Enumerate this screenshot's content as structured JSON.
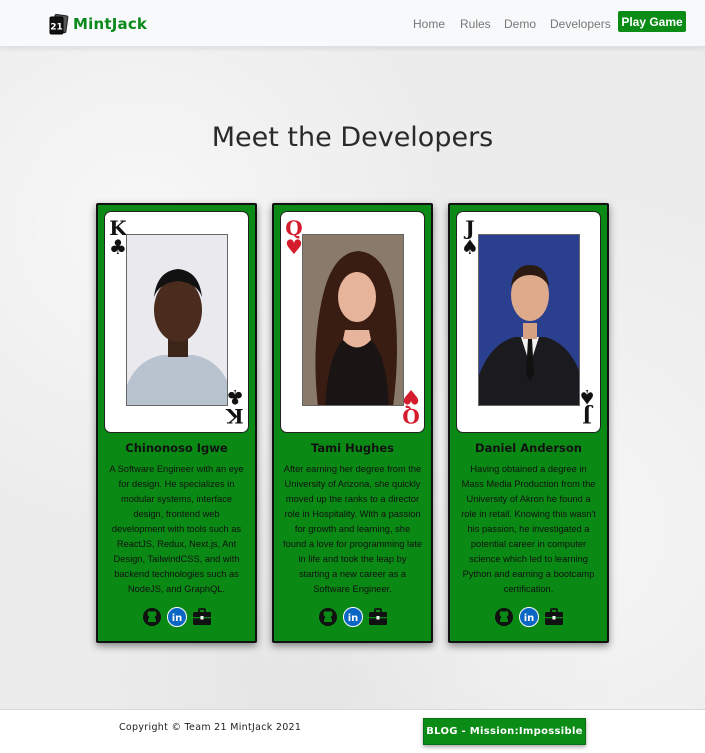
{
  "brand": {
    "name": "MintJack",
    "logo_text": "21"
  },
  "nav": {
    "links": [
      "Home",
      "Rules",
      "Demo",
      "Developers"
    ],
    "play_button": "Play Game"
  },
  "page": {
    "title": "Meet the Developers"
  },
  "developers": [
    {
      "name": "Chinonoso Igwe",
      "card_rank": "K",
      "card_suit": "♣",
      "card_color": "black",
      "bio": "A Software Engineer with an eye for design. He specializes in modular systems, interface design, frontend web development with tools such as ReactJS, Redux, Next.js, Ant Design, TailwindCSS, and with backend technologies such as NodeJS, and GraphQL.",
      "photo_icon": "person-photo"
    },
    {
      "name": "Tami Hughes",
      "card_rank": "Q",
      "card_suit": "♥",
      "card_color": "red",
      "bio": "After earning her degree from the University of Arizona, she quickly moved up the ranks to a director role in Hospitality. With a passion for growth and learning, she found a love for programming late in life and took the leap by starting a new career as a Software Engineer.",
      "photo_icon": "person-photo"
    },
    {
      "name": "Daniel Anderson",
      "card_rank": "J",
      "card_suit": "♠",
      "card_color": "black",
      "bio": "Having obtained a degree in Mass Media Production from the University of Akron he found a role in retail. Knowing this wasn't his passion, he investigated a potential career in computer science which led to learning Python and earning a bootcamp certification.",
      "photo_icon": "person-photo"
    }
  ],
  "social_icons": [
    "github-icon",
    "linkedin-icon",
    "briefcase-icon"
  ],
  "footer": {
    "copyright": "Copyright © Team 21 MintJack 2021",
    "blog_button": "BLOG - Mission:Impossible"
  },
  "colors": {
    "brand_green": "#0b8c16",
    "card_green": "#0a8a14",
    "heart_red": "#d51c2c"
  }
}
